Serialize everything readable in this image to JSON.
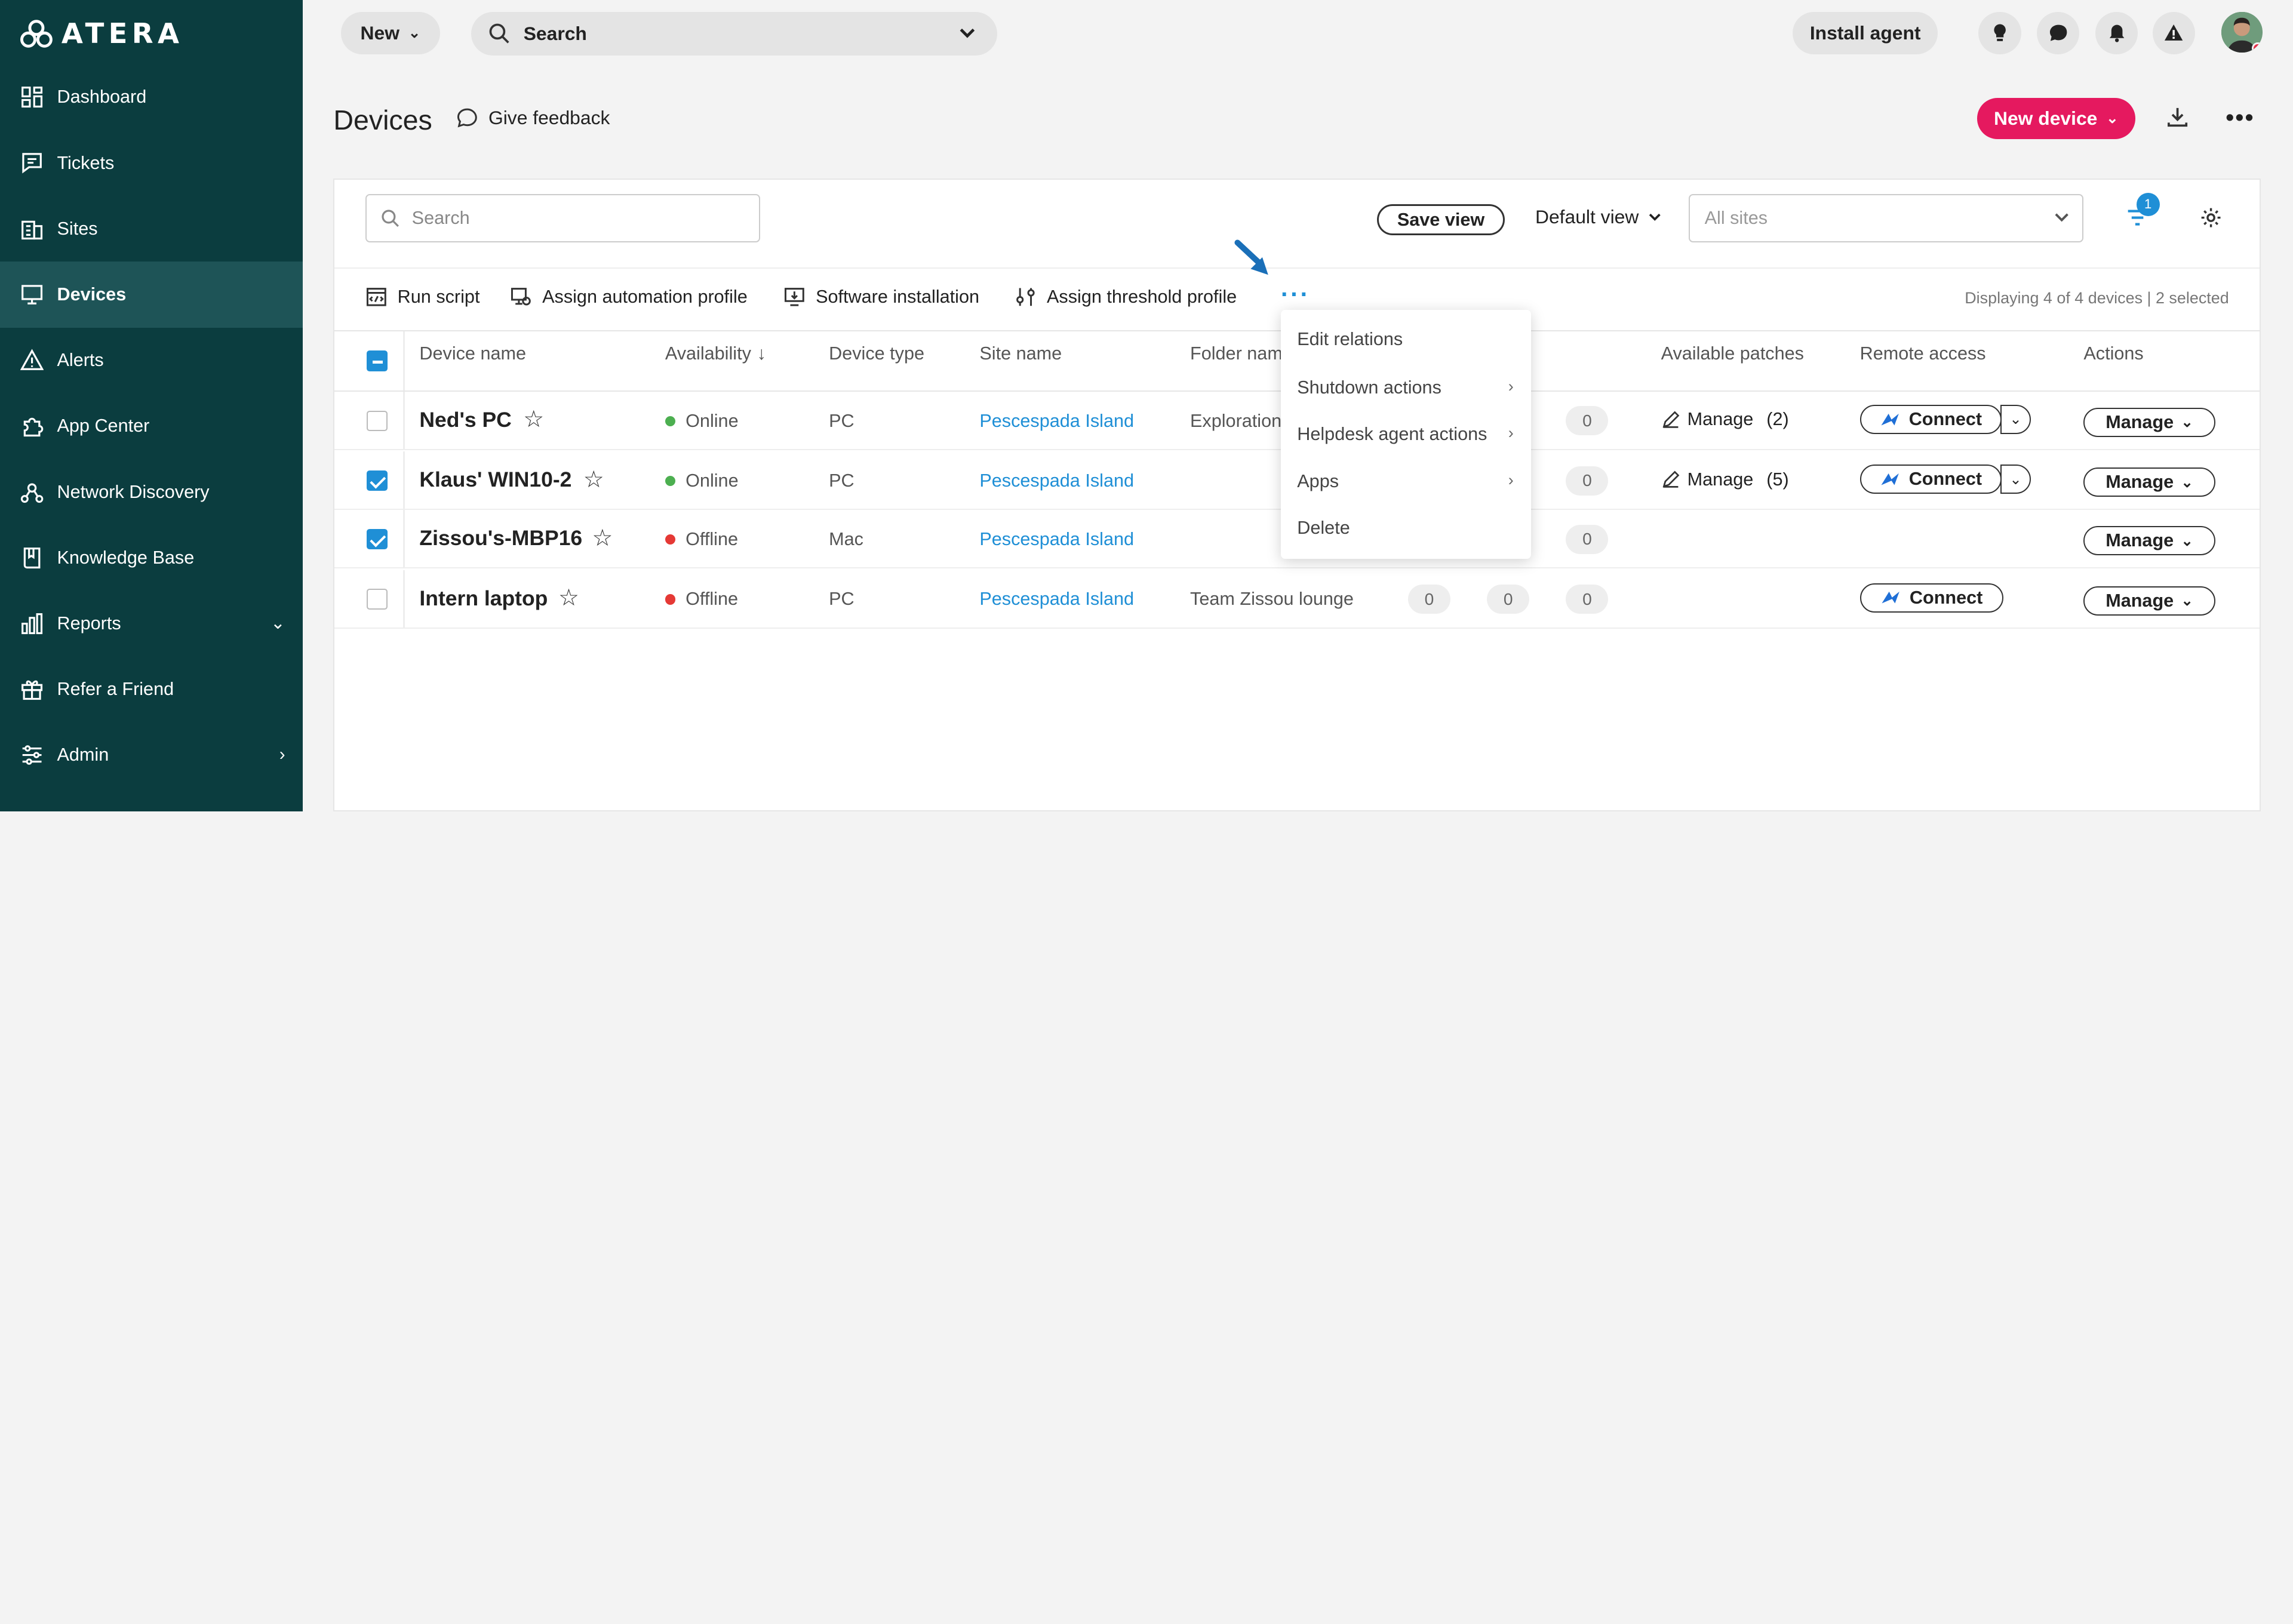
{
  "app": {
    "logo_text": "ATERA"
  },
  "sidebar": {
    "items": [
      {
        "label": "Dashboard",
        "icon": "dashboard-icon"
      },
      {
        "label": "Tickets",
        "icon": "tickets-icon"
      },
      {
        "label": "Sites",
        "icon": "sites-icon"
      },
      {
        "label": "Devices",
        "icon": "devices-icon",
        "active": true
      },
      {
        "label": "Alerts",
        "icon": "alerts-icon"
      },
      {
        "label": "App Center",
        "icon": "app-center-icon"
      },
      {
        "label": "Network Discovery",
        "icon": "network-discovery-icon"
      },
      {
        "label": "Knowledge Base",
        "icon": "knowledge-base-icon"
      },
      {
        "label": "Reports",
        "icon": "reports-icon",
        "chevron": "down"
      },
      {
        "label": "Refer a Friend",
        "icon": "gift-icon"
      },
      {
        "label": "Admin",
        "icon": "admin-icon",
        "chevron": "right"
      }
    ]
  },
  "topbar": {
    "new_label": "New",
    "search_label": "Search",
    "install_label": "Install agent"
  },
  "page": {
    "title": "Devices",
    "feedback_label": "Give feedback",
    "new_device_label": "New device"
  },
  "toolbar": {
    "search_placeholder": "Search",
    "save_view_label": "Save view",
    "default_view_label": "Default view",
    "all_sites_placeholder": "All sites",
    "filter_badge": "1"
  },
  "actions": {
    "run_script": "Run script",
    "assign_automation": "Assign automation profile",
    "software_install": "Software installation",
    "assign_threshold": "Assign threshold profile",
    "more": "···",
    "displaying": "Displaying 4 of 4 devices | 2 selected"
  },
  "table": {
    "headers": {
      "device_name": "Device name",
      "availability": "Availability",
      "device_type": "Device type",
      "site_name": "Site name",
      "folder_name": "Folder nam",
      "available_patches": "Available patches",
      "remote_access": "Remote access",
      "actions": "Actions"
    },
    "rows": [
      {
        "name": "Ned's PC",
        "availability": "Online",
        "status_color": "#4caf50",
        "type": "PC",
        "site": "Pescespada Island",
        "folder": "Exploration",
        "c1": "",
        "c2": "",
        "c3": "0",
        "patch": "Manage",
        "patch_count": "(2)",
        "connect": "Connect",
        "manage": "Manage",
        "checked": false
      },
      {
        "name": "Klaus' WIN10-2",
        "availability": "Online",
        "status_color": "#4caf50",
        "type": "PC",
        "site": "Pescespada Island",
        "folder": "",
        "c1": "",
        "c2": "",
        "c3": "0",
        "patch": "Manage",
        "patch_count": "(5)",
        "connect": "Connect",
        "manage": "Manage",
        "checked": true
      },
      {
        "name": "Zissou's-MBP16",
        "availability": "Offline",
        "status_color": "#e53935",
        "type": "Mac",
        "site": "Pescespada Island",
        "folder": "",
        "c1": "",
        "c2": "",
        "c3": "0",
        "patch": "",
        "patch_count": "",
        "connect": "",
        "manage": "Manage",
        "checked": true
      },
      {
        "name": "Intern laptop",
        "availability": "Offline",
        "status_color": "#e53935",
        "type": "PC",
        "site": "Pescespada Island",
        "folder": "Team Zissou lounge",
        "c1": "0",
        "c2": "0",
        "c3": "0",
        "patch": "",
        "patch_count": "",
        "connect": "Connect",
        "manage": "Manage",
        "checked": false
      }
    ]
  },
  "context_menu": {
    "items": [
      {
        "label": "Edit relations",
        "submenu": false
      },
      {
        "label": "Shutdown actions",
        "submenu": true
      },
      {
        "label": "Helpdesk agent actions",
        "submenu": true
      },
      {
        "label": "Apps",
        "submenu": true
      },
      {
        "label": "Delete",
        "submenu": false
      }
    ]
  },
  "colors": {
    "sidebar_bg": "#0b3d3f",
    "sidebar_active": "#1e5457",
    "accent_pink": "#e5195f",
    "link_blue": "#1f8fd6"
  }
}
